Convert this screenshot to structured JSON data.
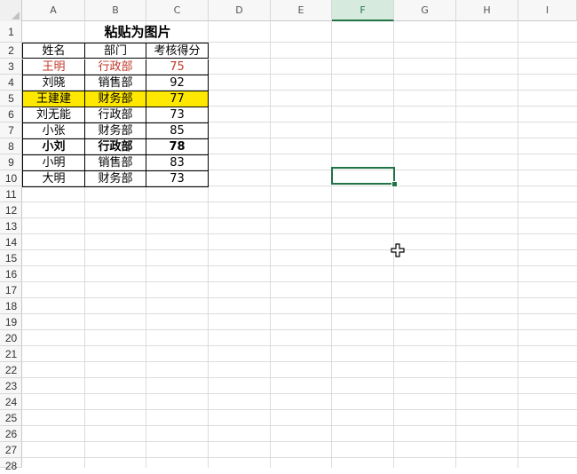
{
  "columns": [
    "A",
    "B",
    "C",
    "D",
    "E",
    "F",
    "G",
    "H",
    "I"
  ],
  "active_column": "F",
  "rows": [
    "1",
    "2",
    "3",
    "4",
    "5",
    "6",
    "7",
    "8",
    "9",
    "10",
    "11",
    "12",
    "13",
    "14",
    "15",
    "16",
    "17",
    "18",
    "19",
    "20",
    "21",
    "22",
    "23",
    "24",
    "25",
    "26",
    "27",
    "28"
  ],
  "sheet": {
    "title": "粘贴为图片",
    "headers": [
      "姓名",
      "部门",
      "考核得分"
    ],
    "records": [
      {
        "name": "王明",
        "dept": "行政部",
        "score": "75",
        "style": "red"
      },
      {
        "name": "刘晓",
        "dept": "销售部",
        "score": "92",
        "style": ""
      },
      {
        "name": "王建建",
        "dept": "财务部",
        "score": "77",
        "style": "yellow"
      },
      {
        "name": "刘无能",
        "dept": "行政部",
        "score": "73",
        "style": ""
      },
      {
        "name": "小张",
        "dept": "财务部",
        "score": "85",
        "style": ""
      },
      {
        "name": "小刘",
        "dept": "行政部",
        "score": "78",
        "style": "bold"
      },
      {
        "name": "小明",
        "dept": "销售部",
        "score": "83",
        "style": ""
      },
      {
        "name": "大明",
        "dept": "财务部",
        "score": "73",
        "style": ""
      }
    ]
  },
  "selected_cell": "F10",
  "colors": {
    "accent": "#217346",
    "highlight": "#ffe800",
    "red_text": "#c0392b"
  },
  "cursor_icon": "move-cross-cursor-icon"
}
